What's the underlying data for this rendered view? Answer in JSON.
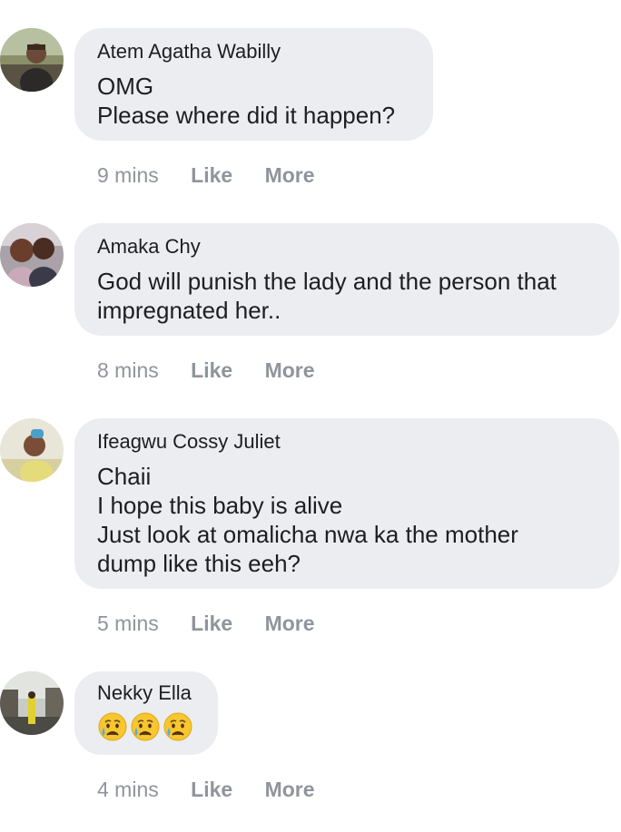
{
  "comments": [
    {
      "author": "Atem Agatha Wabilly",
      "lines": [
        "OMG",
        "Please where did it happen?"
      ],
      "time": "9 mins",
      "like": "Like",
      "more": "More"
    },
    {
      "author": "Amaka Chy",
      "lines": [
        "God will punish the lady and the person that",
        "impregnated her.."
      ],
      "time": "8 mins",
      "like": "Like",
      "more": "More"
    },
    {
      "author": "Ifeagwu Cossy Juliet",
      "lines": [
        "Chaii",
        "I hope this baby is alive",
        "Just look at omalicha nwa ka the mother",
        "dump like this eeh?"
      ],
      "time": "5 mins",
      "like": "Like",
      "more": "More"
    },
    {
      "author": "Nekky Ella",
      "emojis": [
        "disappointed-relieved-face",
        "disappointed-relieved-face",
        "disappointed-relieved-face"
      ],
      "time": "4 mins",
      "like": "Like",
      "more": "More"
    }
  ],
  "colors": {
    "bubble": "#ebedf0",
    "text": "#1c1e21",
    "meta": "#90949c"
  }
}
